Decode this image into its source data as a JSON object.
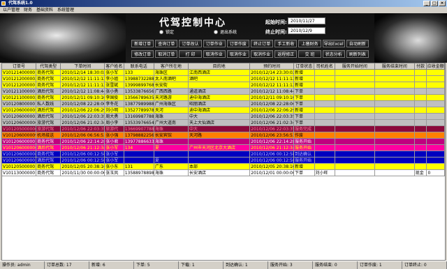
{
  "window": {
    "title": "代驾系统1.0",
    "min": "_",
    "max": "□",
    "close": "×"
  },
  "menu": [
    "以户管理",
    "财务",
    "基础资料",
    "系统管理"
  ],
  "banner": {
    "title": "代驾控制中心",
    "radio1": "锁定",
    "radio2": "退出系统",
    "start_label": "起始时间:",
    "start_value": "2010/11/27",
    "end_label": "终止时间:",
    "end_value": "2010/12/9"
  },
  "buttons_row1": [
    "新增订单",
    "查询订单",
    "订单改认",
    "订单作业",
    "订单作废",
    "终止订单",
    "手工新收",
    "上缴财务",
    "导出Excel",
    "自动刷新"
  ],
  "buttons_row2": [
    "修改订单",
    "取消订单",
    "打  印",
    "取消作业",
    "取消作业",
    "取消作业",
    "返程修正",
    "交  班",
    "状态分析",
    "刷新列表"
  ],
  "columns": [
    "订单号",
    "代驾类型",
    "下单时间",
    "客户姓名",
    "联系电话",
    "客户所在地",
    "目的地",
    "预约时间",
    "订单状态",
    "司机姓名",
    "服务开始时间",
    "服务结束时间",
    "付款",
    "应收金额"
  ],
  "rows": [
    [
      "V101214000001",
      "商务代驾",
      "2010/12/14 18:30:02",
      "张小军",
      "133",
      "海珠区",
      "江南西酒店",
      "2010/12/14 23:30:02",
      "新增",
      "",
      "",
      "",
      "",
      ""
    ],
    [
      "V101212000002",
      "商务代驾",
      "2010/12/12 11:11:12",
      "李小姐",
      "13988732288",
      "太人南酒吧",
      "酒吧",
      "2010/12/12 11:11:12",
      "新增",
      "",
      "",
      "",
      "",
      ""
    ],
    [
      "V101212000001",
      "商务代驾",
      "2010/12/12 11:11:12",
      "张雪斌",
      "13999899768",
      "长安街",
      "",
      "2010/12/12 11:11:12",
      "新增",
      "",
      "",
      "",
      "",
      ""
    ],
    [
      "V101211000001",
      "酒后代驾",
      "2010/12/12 11:08:44",
      "张小勇",
      "13533876656",
      "广西西路",
      "通道酒店",
      "2010/12/12 11:08:44",
      "下单",
      "",
      "",
      "",
      "",
      ""
    ],
    [
      "V101211000002",
      "商务代驾",
      "2010/12/11 09:10:10",
      "李国俊",
      "13566789635",
      "天河路游",
      "迪中海酒店",
      "2010/12/11 09:10:10",
      "下单",
      "",
      "",
      "",
      "",
      ""
    ],
    [
      "V101208000001",
      "私人数线",
      "2010/12/08 22:28:06",
      "李冬花",
      "13877989988",
      "广州海珠区",
      "昭丽酒店",
      "2010/12/08 22:28:06",
      "下单",
      "",
      "",
      "",
      "",
      ""
    ],
    [
      "V101206000005",
      "酒后代驾",
      "2010/12/06 22:06:29",
      "刘小明",
      "13527789978",
      "天河",
      "迪中海酒店",
      "2010/12/06 22:06:29",
      "新增",
      "",
      "",
      "",
      "",
      ""
    ],
    [
      "V101206000003",
      "酒后代驾",
      "2010/12/06 22:03:35",
      "周大勇",
      "13169987788",
      "海珠",
      "中大",
      "2010/12/06 22:03:35",
      "下单",
      "",
      "",
      "",
      "",
      ""
    ],
    [
      "V101206000006",
      "旅游代驾",
      "2010/12/06 21:02:34",
      "周小李",
      "13533976654",
      "广州大道南",
      "天上大仙酒店",
      "2010/12/06 21:02:34",
      "下单",
      "",
      "",
      "",
      "",
      ""
    ],
    [
      "V101205000006",
      "旅游代驾",
      "2010/12/06 22:03:35",
      "旅游代",
      "13669907788",
      "海珠",
      "中大",
      "2010/12/06 22:03:35",
      "服务完成",
      "",
      "",
      "",
      "",
      ""
    ],
    [
      "V101206000009",
      "机场接送",
      "2010/12/06 06:56:53",
      "张小强",
      "13798882256",
      "长安宾馆",
      "天河路",
      "2010/12/06 23:56:53",
      "作废",
      "",
      "",
      "",
      "",
      ""
    ],
    [
      "V101206000007",
      "商务代驾",
      "2010/12/06 22:14:28",
      "张小君",
      "13977886633",
      "海珠",
      "",
      "2010/12/06 22:14:28",
      "服务开始",
      "",
      "",
      "",
      "",
      ""
    ],
    [
      "V101206000006",
      "酒后代驾",
      "2010/12/06 21:12:34",
      "张小军",
      "134",
      "夏",
      "广州市天河区北京大酒店",
      "2010/12/06 21:12:34",
      "服务开始",
      "",
      "",
      "",
      "",
      ""
    ],
    [
      "V101206000008",
      "商务代驾",
      "2010/12/06 00:12:58",
      "张小军",
      "",
      "",
      "",
      "2010/12/06 00:12:58",
      "到达确认",
      "",
      "",
      "",
      "",
      ""
    ],
    [
      "V101206000001",
      "酒后代驾",
      "2010/12/06 00:12:58",
      "张小军",
      "",
      "夏",
      "",
      "2010/12/06 00:12:58",
      "服务开始",
      "",
      "",
      "",
      "",
      ""
    ],
    [
      "V101205000001",
      "商务代驾",
      "2010/12/05 20:38:16",
      "张小东",
      "131",
      "广东",
      "本部",
      "2010/12/05 20:38:16",
      "新增",
      "",
      "",
      "",
      "",
      ""
    ],
    [
      "V101130000001",
      "商务代驾",
      "2010/11/30 00:00:00",
      "张玉凤",
      "13588978898",
      "海珠",
      "长安酒店",
      "2010/12/01 00:00:00",
      "下单",
      "刘小旺",
      "",
      "",
      "现金",
      "0"
    ]
  ],
  "row_colors": [
    "#ffff00",
    "#ffff00",
    "#ffff00",
    "#c0c0c0",
    "#ffff00",
    "#c0c0c0",
    "#ffff00",
    "#c0c0c0",
    "#c0c0c0",
    "#8b0a3c",
    "#ff7f00",
    "#c0007f",
    "#ff00a0",
    "#0000c0",
    "#0000c0",
    "#ffff00",
    "#ffffff"
  ],
  "row_text_colors": [
    "#000",
    "#000",
    "#000",
    "#000",
    "#000",
    "#000",
    "#000",
    "#000",
    "#000",
    "#ff80a0",
    "#000",
    "#fff",
    "#ffff00",
    "#c0c0ff",
    "#c0c0ff",
    "#000",
    "#000"
  ],
  "status": [
    "操作员: admin",
    "订单总数: 17",
    "新增: 6",
    "下单: 5",
    "下载: 1",
    "到达确认: 1",
    "服务开始: 3",
    "服务结束: 0",
    "订单作废: 1",
    "订单终止: 0"
  ]
}
